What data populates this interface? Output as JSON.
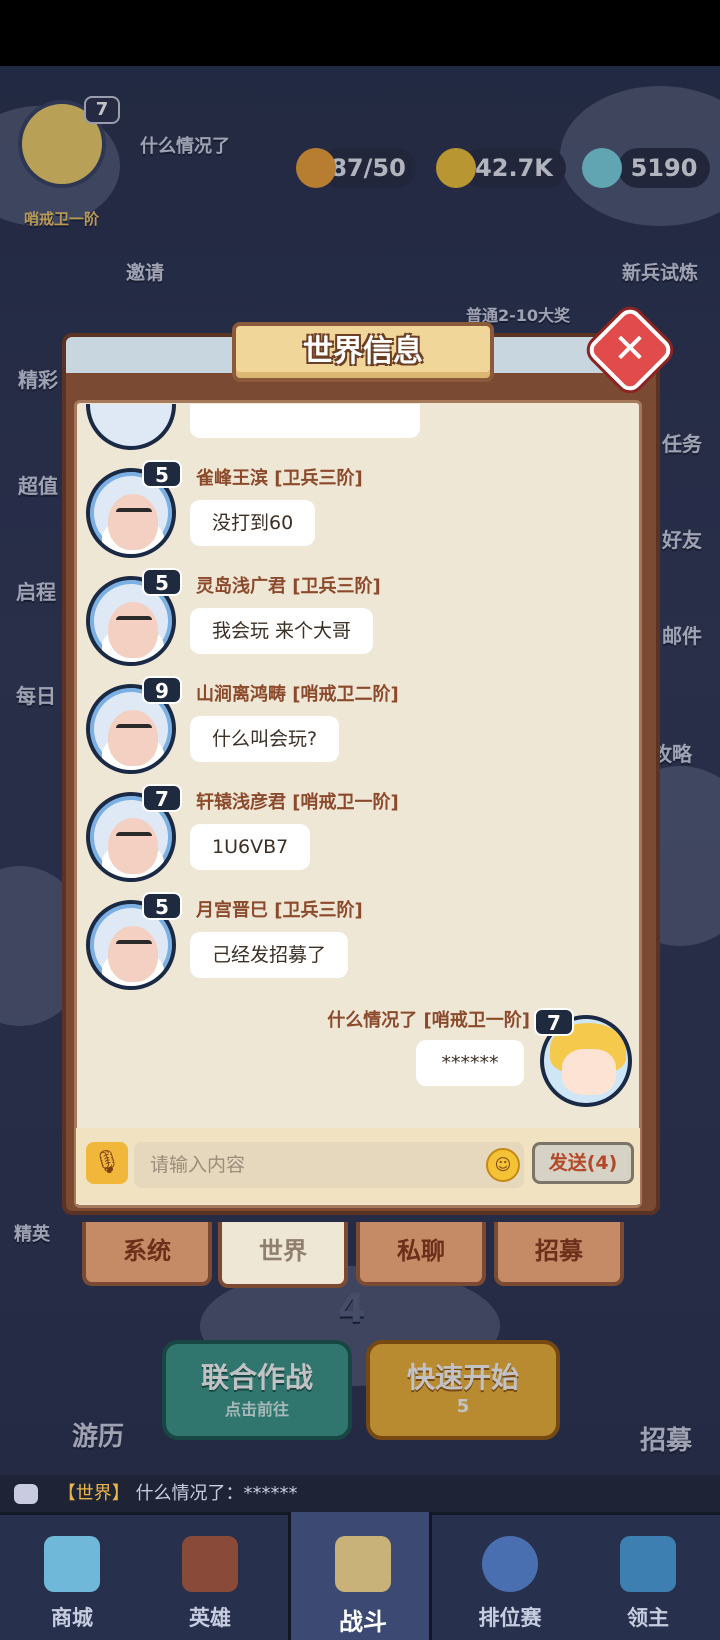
{
  "hud": {
    "player_level": "7",
    "player_name": "什么情况了",
    "player_rank": "哨戒卫一阶",
    "stamina": "87/50",
    "gold": "42.7K",
    "gems": "5190",
    "invite": "邀请",
    "new_trial": "新兵试炼",
    "reward_hint": "普通2-10大奖"
  },
  "side_left": [
    "精彩",
    "超值",
    "启程",
    "每日"
  ],
  "side_right": [
    "任务",
    "好友",
    "邮件",
    "攻略"
  ],
  "dialog": {
    "title": "世界信息",
    "messages": [
      {
        "level": "5",
        "name": "雀峰王滨  [卫兵三阶]",
        "text": "没打到60"
      },
      {
        "level": "5",
        "name": "灵岛浅广君  [卫兵三阶]",
        "text": "我会玩 来个大哥"
      },
      {
        "level": "9",
        "name": "山涧离鸿畴  [哨戒卫二阶]",
        "text": "什么叫会玩?"
      },
      {
        "level": "7",
        "name": "轩辕浅彦君  [哨戒卫一阶]",
        "text": "1U6VB7"
      },
      {
        "level": "5",
        "name": "月宫晋巳  [卫兵三阶]",
        "text": "己经发招募了"
      }
    ],
    "self": {
      "level": "7",
      "name": "什么情况了  [哨戒卫一阶]",
      "text": "******"
    },
    "input_placeholder": "请输入内容",
    "send_label": "发送(4)",
    "tabs": [
      "系统",
      "世界",
      "私聊",
      "招募"
    ]
  },
  "background_labels": {
    "elite": "精英",
    "travel": "游历",
    "recruit": "招募",
    "joint_battle": "联合作战",
    "joint_battle_sub": "点击前往",
    "quick_start": "快速开始",
    "quick_start_cost": "5",
    "stage_number": "4"
  },
  "chat_ticker": {
    "channel": "【世界】",
    "text": "什么情况了：******"
  },
  "nav": [
    "商城",
    "英雄",
    "战斗",
    "排位赛",
    "领主"
  ],
  "colors": {
    "accent": "#e24b4b",
    "panel": "#7a4a33",
    "paper": "#efe7d6",
    "name": "#8c4a2c"
  }
}
